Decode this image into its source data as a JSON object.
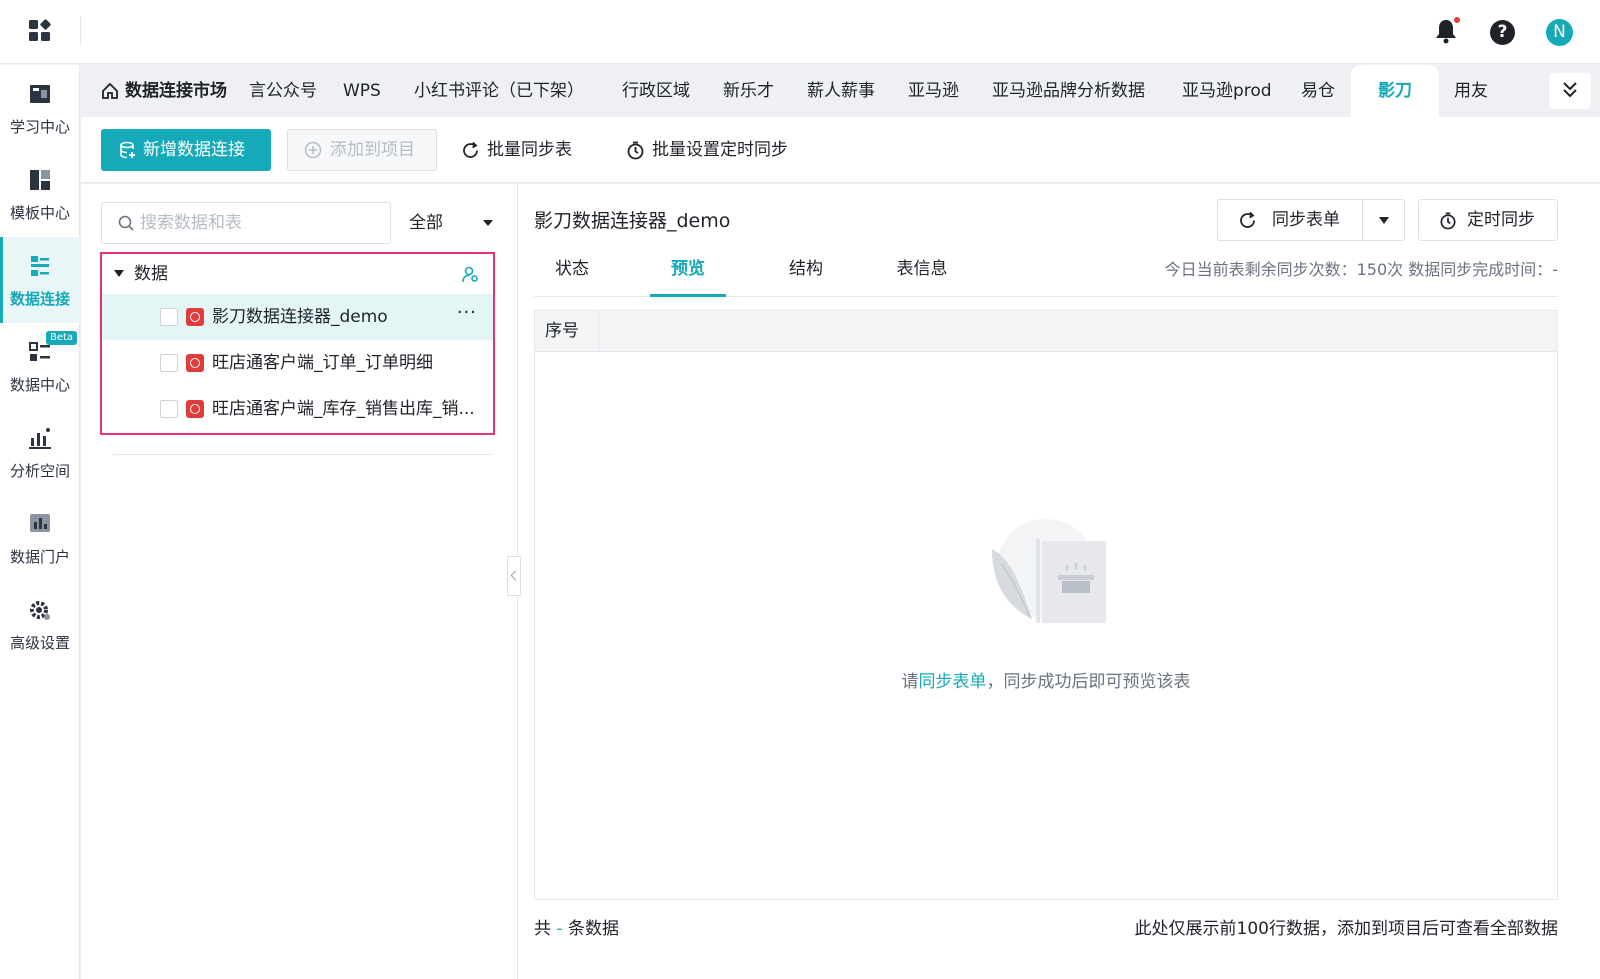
{
  "colors": {
    "accent": "#16a9b8",
    "highlight_border": "#e6336b",
    "connector_icon": "#e03c3c",
    "notification_dot": "#f03b3b"
  },
  "header": {
    "user_initial": "N",
    "icons": [
      "apps-grid-icon",
      "bell-icon",
      "help-icon"
    ]
  },
  "sidebar": {
    "items": [
      {
        "label": "学习中心",
        "icon": "book-icon"
      },
      {
        "label": "模板中心",
        "icon": "template-icon"
      },
      {
        "label": "数据连接",
        "icon": "data-connection-icon",
        "active": true
      },
      {
        "label": "数据中心",
        "icon": "data-center-icon",
        "badge": "Beta"
      },
      {
        "label": "分析空间",
        "icon": "analysis-icon"
      },
      {
        "label": "数据门户",
        "icon": "portal-icon"
      },
      {
        "label": "高级设置",
        "icon": "gear-icon"
      }
    ]
  },
  "tabs": {
    "market": "数据连接市场",
    "items": [
      "言公众号",
      "WPS",
      "小红书评论（已下架）",
      "行政区域",
      "新乐才",
      "薪人薪事",
      "亚马逊",
      "亚马逊品牌分析数据",
      "亚马逊prod",
      "易仓",
      "影刀",
      "用友"
    ],
    "active": "影刀"
  },
  "toolbar": {
    "new_connection": "新增数据连接",
    "add_to_project": "添加到项目",
    "batch_sync": "批量同步表",
    "batch_schedule": "批量设置定时同步"
  },
  "left": {
    "search_placeholder": "搜索数据和表",
    "filter_value": "全部",
    "tree_root": "数据",
    "tree_items": [
      {
        "name": "影刀数据连接器_demo",
        "selected": true,
        "more": "···"
      },
      {
        "name": "旺店通客户端_订单_订单明细"
      },
      {
        "name": "旺店通客户端_库存_销售出库_销..."
      }
    ]
  },
  "detail": {
    "title": "影刀数据连接器_demo",
    "sync_button": "同步表单",
    "timer_button": "定时同步",
    "subtabs": [
      "状态",
      "预览",
      "结构",
      "表信息"
    ],
    "active_subtab": "预览",
    "sync_info": "今日当前表剩余同步次数：150次   数据同步完成时间：-",
    "table_header": "序号",
    "empty_prefix": "请",
    "empty_link": "同步表单",
    "empty_suffix": "，同步成功后即可预览该表",
    "footer_prefix": "共",
    "footer_dash": "-",
    "footer_suffix": "条数据",
    "footer_note": "此处仅展示前100行数据，添加到项目后可查看全部数据"
  }
}
